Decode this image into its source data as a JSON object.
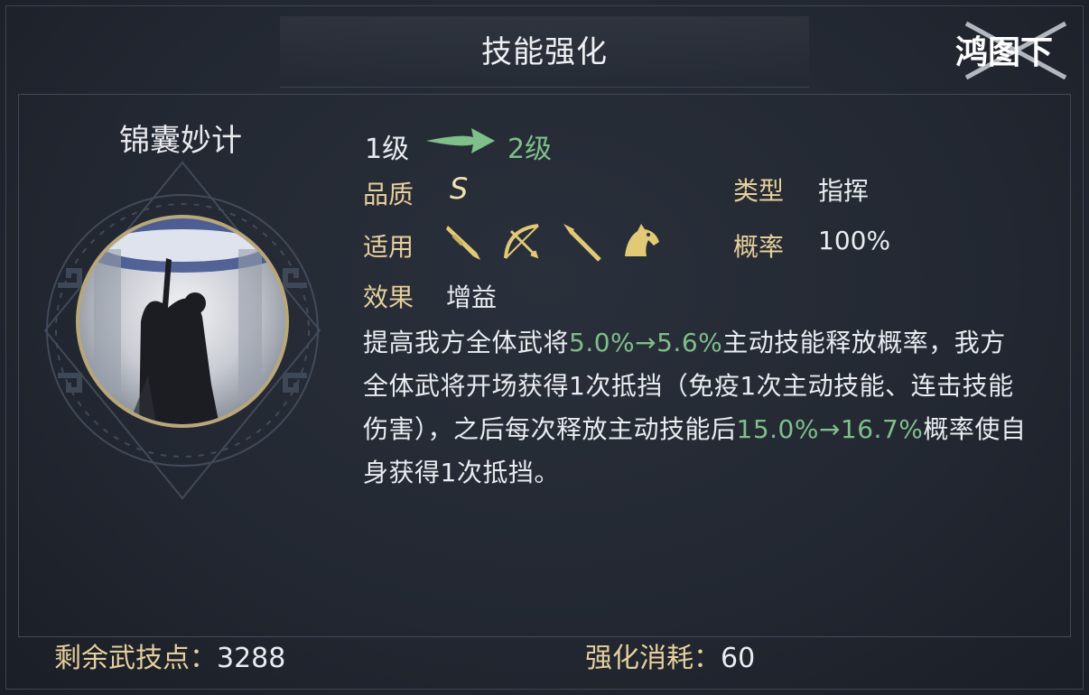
{
  "header": {
    "title": "技能强化",
    "logo_text": "鸿图之下"
  },
  "skill": {
    "name": "锦囊妙计",
    "level_from": "1级",
    "level_to": "2级",
    "quality_label": "品质",
    "quality_value": "S",
    "type_label": "类型",
    "type_value": "指挥",
    "applicable_label": "适用",
    "applicable_icons": [
      "sword-icon",
      "bow-icon",
      "spear-icon",
      "horse-icon"
    ],
    "chance_label": "概率",
    "chance_value": "100%",
    "effect_label": "效果",
    "effect_value": "增益",
    "description": {
      "p1": "提高我方全体武将",
      "h1": "5.0%→5.6%",
      "p2": "主动技能释放概率，我方全体武将开场获得1次抵挡（免疫1次主动技能、连击技能伤害），之后每次释放主动技能后",
      "h2": "15.0%→16.7%",
      "p3": "概率使自身获得1次抵挡。"
    }
  },
  "footer": {
    "remaining_label": "剩余武技点：",
    "remaining_value": "3288",
    "cost_label": "强化消耗：",
    "cost_value": "60"
  },
  "colors": {
    "gold": "#e6cf9c",
    "highlight_green": "#7fbf8a",
    "text": "#e9ecf0"
  }
}
